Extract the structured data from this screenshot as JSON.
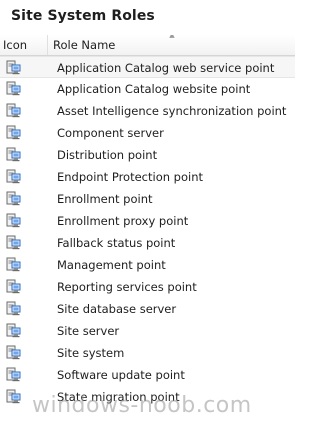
{
  "panel": {
    "title": "Site System Roles"
  },
  "columns": {
    "icon": "Icon",
    "role_name": "Role Name"
  },
  "rows": [
    {
      "label": "Application Catalog web service point"
    },
    {
      "label": "Application Catalog website point"
    },
    {
      "label": "Asset Intelligence synchronization point"
    },
    {
      "label": "Component server"
    },
    {
      "label": "Distribution point"
    },
    {
      "label": "Endpoint Protection point"
    },
    {
      "label": "Enrollment point"
    },
    {
      "label": "Enrollment proxy point"
    },
    {
      "label": "Fallback status point"
    },
    {
      "label": "Management point"
    },
    {
      "label": "Reporting services point"
    },
    {
      "label": "Site database server"
    },
    {
      "label": "Site server"
    },
    {
      "label": "Site system"
    },
    {
      "label": "Software update point"
    },
    {
      "label": "State migration point"
    }
  ],
  "row_icon": "server-role-icon",
  "sort": {
    "column": "Role Name",
    "direction": "ascending"
  },
  "watermark": "windows-noob.com",
  "colors": {
    "accent_blue": "#2f6fc4",
    "header_border": "#d5d5d5",
    "text": "#1e1e1e"
  }
}
